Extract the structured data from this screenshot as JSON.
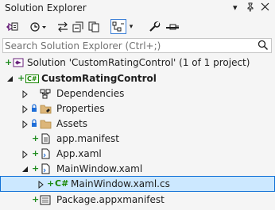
{
  "title": "Solution Explorer",
  "search": {
    "placeholder": "Search Solution Explorer (Ctrl+;)"
  },
  "tree": {
    "solution": "Solution 'CustomRatingControl' (1 of 1 project)",
    "project": "CustomRatingControl",
    "dependencies": "Dependencies",
    "properties": "Properties",
    "assets": "Assets",
    "app_manifest": "app.manifest",
    "app_xaml": "App.xaml",
    "mainwindow_xaml": "MainWindow.xaml",
    "mainwindow_cs": "MainWindow.xaml.cs",
    "package_manifest": "Package.appxmanifest"
  },
  "badges": {
    "csharp": "C#",
    "plus": "+"
  },
  "colors": {
    "selection": "#cce8ff",
    "selection_border": "#0f70d7",
    "added": "#1e8c1e",
    "csharp": "#178600",
    "vs_purple": "#68217a"
  }
}
